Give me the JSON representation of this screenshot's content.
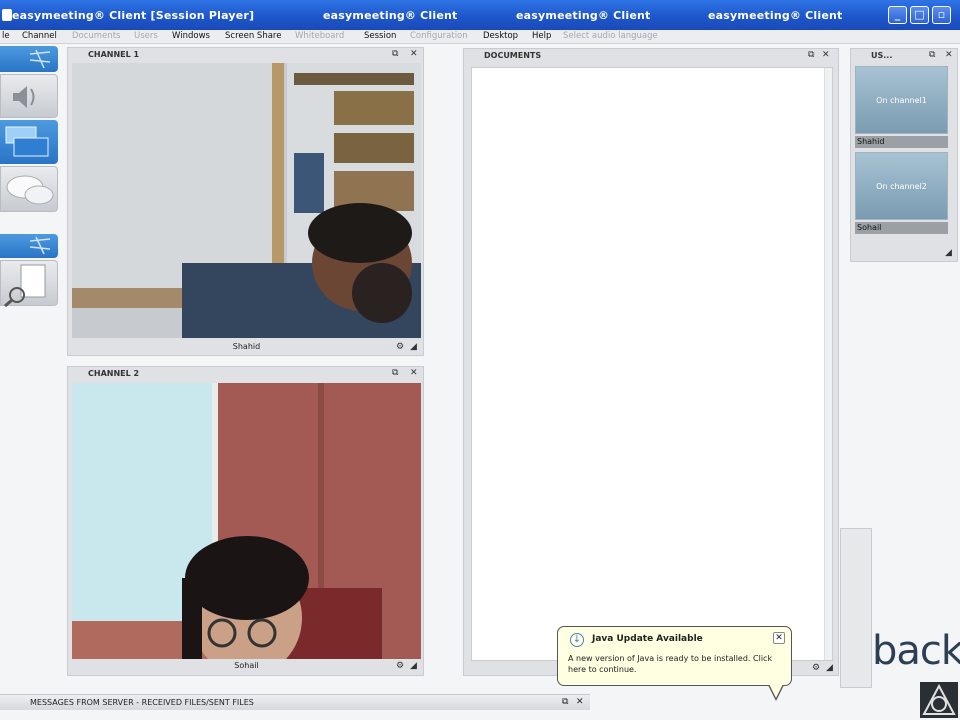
{
  "titlebar": {
    "title_1": "easymeeting® Client  [Session Player]",
    "title_2": "easymeeting® Client",
    "title_3": "easymeeting® Client",
    "title_4": "easymeeting® Client"
  },
  "menu": {
    "items": [
      {
        "label": "le",
        "enabled": true
      },
      {
        "label": "Channel",
        "enabled": true
      },
      {
        "label": "Documents",
        "enabled": false
      },
      {
        "label": "Users",
        "enabled": false
      },
      {
        "label": "Windows",
        "enabled": true
      },
      {
        "label": "Screen Share",
        "enabled": true
      },
      {
        "label": "Whiteboard",
        "enabled": false
      },
      {
        "label": "Session",
        "enabled": true
      },
      {
        "label": "Configuration",
        "enabled": false
      },
      {
        "label": "Desktop",
        "enabled": true
      },
      {
        "label": "Help",
        "enabled": true
      },
      {
        "label": "Select audio language",
        "enabled": false
      }
    ]
  },
  "channel1": {
    "title": "CHANNEL 1",
    "participant": "Shahid"
  },
  "channel2": {
    "title": "CHANNEL 2",
    "participant": "Sohail"
  },
  "documents": {
    "title": "DOCUMENTS"
  },
  "users": {
    "title": "US...",
    "list": [
      {
        "status": "On channel1",
        "name": "Shahid"
      },
      {
        "status": "On channel2",
        "name": "Sohail"
      }
    ]
  },
  "bottom": {
    "messages_label": "MESSAGES FROM SERVER - RECEIVED FILES/SENT FILES"
  },
  "java_notice": {
    "heading": "Java Update Available",
    "body": "A new version of Java is ready to be installed. Click here to continue."
  },
  "background": {
    "brand_text": "back"
  },
  "colors": {
    "titlebar": "#1d55c8",
    "balloon": "#ffffe1",
    "panel": "#dfe1e4"
  }
}
